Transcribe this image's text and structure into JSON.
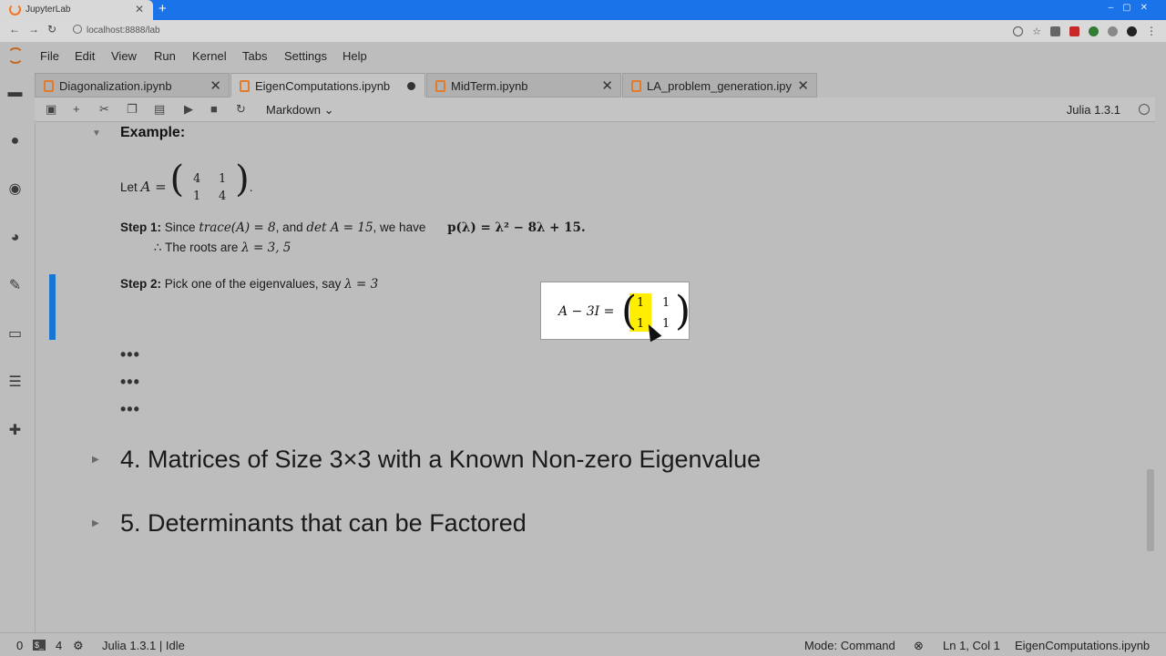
{
  "browser": {
    "tab_title": "JupyterLab",
    "url": "localhost:8888/lab",
    "new_tab": "+",
    "close": "✕"
  },
  "menu": [
    "File",
    "Edit",
    "View",
    "Run",
    "Kernel",
    "Tabs",
    "Settings",
    "Help"
  ],
  "tabs": [
    {
      "label": "Diagonalization.ipynb",
      "state": "close"
    },
    {
      "label": "EigenComputations.ipynb",
      "state": "modified"
    },
    {
      "label": "MidTerm.ipynb",
      "state": "close"
    },
    {
      "label": "LA_problem_generation.ipy",
      "state": "close"
    }
  ],
  "toolbar": {
    "cell_type": "Markdown",
    "kernel": "Julia 1.3.1"
  },
  "content": {
    "example_heading": "Example:",
    "let_text": "Let",
    "matrix_A": {
      "rows": [
        [
          "4",
          "1"
        ],
        [
          "1",
          "4"
        ]
      ]
    },
    "step1_label": "Step 1:",
    "step1_since": "Since",
    "step1_and": ", and",
    "step1_we_have": ", we have",
    "trace_expr": "trace(A) = 8",
    "det_expr": "det A = 15",
    "poly_expr": "p(λ) = λ² − 8λ + 15.",
    "therefore": "∴",
    "roots_text": "The roots are",
    "roots_expr": "λ = 3, 5",
    "step2_label": "Step 2:",
    "step2_text": "Pick one of the eigenvalues, say",
    "step2_expr": "λ = 3",
    "popup": {
      "lhs": "A − 3I =",
      "matrix": [
        [
          "1",
          "1"
        ],
        [
          "1",
          "1"
        ]
      ]
    },
    "ellipsis": "•••",
    "section4": "4. Matrices of Size 3×3 with a Known Non-zero Eigenvalue",
    "section5": "5. Determinants that can be Factored"
  },
  "status": {
    "zero": "0",
    "terminals": "4",
    "kernel_status": "Julia 1.3.1 | Idle",
    "mode": "Mode: Command",
    "position": "Ln 1, Col 1",
    "file": "EigenComputations.ipynb"
  }
}
